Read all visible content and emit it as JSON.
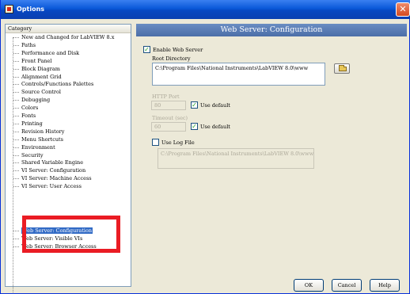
{
  "window": {
    "title": "Options",
    "close_glyph": "✕"
  },
  "category": {
    "header": "Category",
    "items": [
      "New and Changed for LabVIEW 8.x",
      "Paths",
      "Performance and Disk",
      "Front Panel",
      "Block Diagram",
      "Alignment Grid",
      "Controls/Functions Palettes",
      "Source Control",
      "Debugging",
      "Colors",
      "Fonts",
      "Printing",
      "Revision History",
      "Menu Shortcuts",
      "Environment",
      "Security",
      "Shared Variable Engine",
      "VI Server: Configuration",
      "VI Server: Machine Access",
      "VI Server: User Access",
      "Web Server: Configuration",
      "Web Server: Visible VIs",
      "Web Server: Browser Access"
    ],
    "selected": "Web Server: Configuration"
  },
  "config": {
    "header": "Web Server: Configuration",
    "enable_web_server": {
      "label": "Enable Web Server",
      "checked": true
    },
    "root_directory": {
      "label": "Root Directory",
      "value": "C:\\Program Files\\National Instruments\\LabVIEW 8.0\\www"
    },
    "http_port": {
      "label": "HTTP Port",
      "value": "80",
      "use_default_label": "Use default",
      "use_default_checked": true
    },
    "timeout": {
      "label": "Timeout (sec)",
      "value": "60",
      "use_default_label": "Use default",
      "use_default_checked": true
    },
    "use_log_file": {
      "label": "Use Log File",
      "checked": false,
      "value": "C:\\Program Files\\National Instruments\\LabVIEW 8.0\\www.log"
    }
  },
  "buttons": {
    "ok": "OK",
    "cancel": "Cancel",
    "help": "Help"
  },
  "icons": {
    "browse": "folder-open-icon",
    "app": "options-app-icon"
  },
  "colors": {
    "title_bar": "#0a58d8",
    "section_header": "#5a7db5",
    "selection": "#316ac5",
    "highlight_box": "#ea1c24"
  }
}
